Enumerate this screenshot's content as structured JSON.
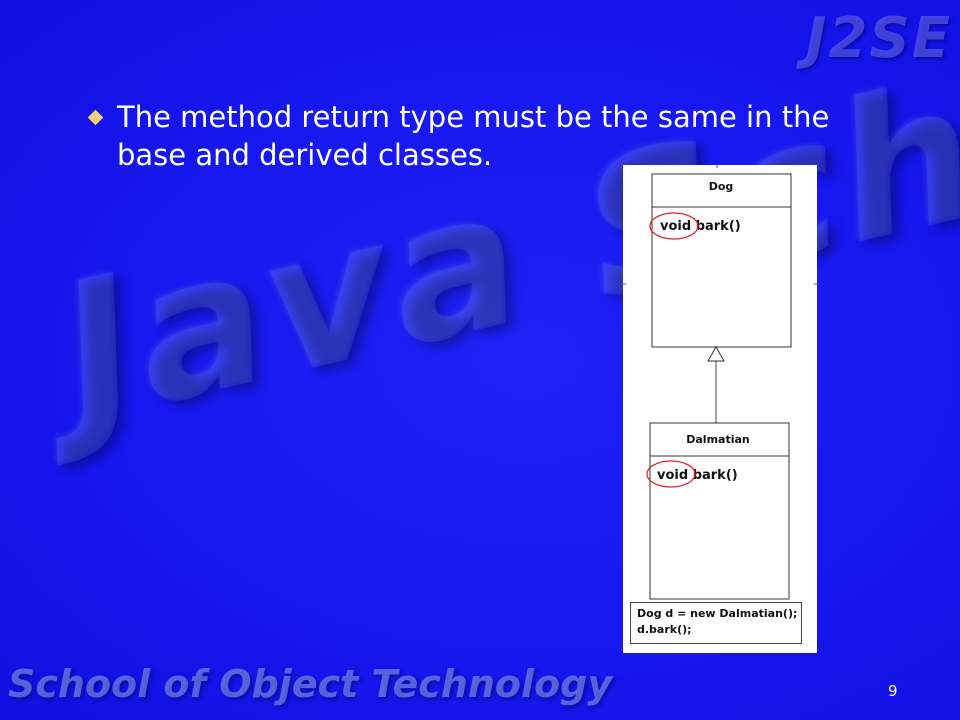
{
  "slide": {
    "watermark_text": "Java School",
    "brand_text": "J2SE",
    "footer_text": "School of Object Technology",
    "page_number": "9",
    "bullet_text": "The method return type must be the same in the base and derived classes.",
    "colors": {
      "background": "#1414ee",
      "bullet": "#f1d27a",
      "highlight": "#e0202a"
    }
  },
  "diagram": {
    "base_class": {
      "name": "Dog",
      "method": "void bark()"
    },
    "derived_class": {
      "name": "Dalmatian",
      "method": "void bark()"
    },
    "code": [
      "Dog d = new Dalmatian();",
      "d.bark();"
    ]
  }
}
